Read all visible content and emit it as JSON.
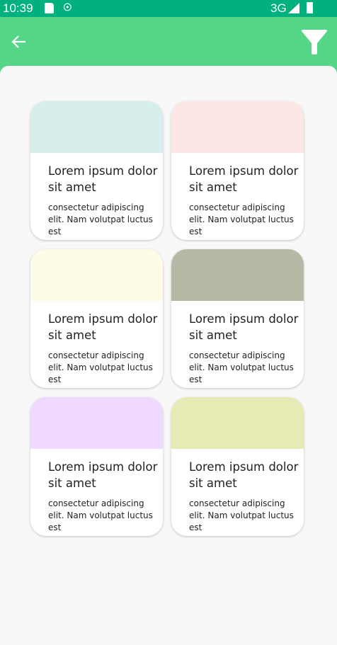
{
  "status_bar": {
    "time": "10:39",
    "network": "3G",
    "icons": [
      "sd-card-icon",
      "debug-icon",
      "signal-icon",
      "battery-icon"
    ]
  },
  "app_bar": {
    "back_icon": "arrow-left-icon",
    "filter_icon": "filter-icon"
  },
  "colors": {
    "status_bar": "#00b07d",
    "app_bar": "#55d686",
    "background": "#f8f8f8"
  },
  "cards": [
    {
      "title": "Lorem ipsum dolor sit amet",
      "body": "consectetur adipiscing elit. Nam volutpat luctus est",
      "color": "#d6efec"
    },
    {
      "title": "Lorem ipsum dolor sit amet",
      "body": "consectetur adipiscing elit. Nam volutpat luctus est",
      "color": "#fde7e6"
    },
    {
      "title": "Lorem ipsum dolor sit amet",
      "body": "consectetur adipiscing elit. Nam volutpat luctus est",
      "color": "#fefbe6"
    },
    {
      "title": "Lorem ipsum dolor sit amet",
      "body": "consectetur adipiscing elit. Nam volutpat luctus est",
      "color": "#b5b9a5"
    },
    {
      "title": "Lorem ipsum dolor sit amet",
      "body": "consectetur adipiscing elit. Nam volutpat luctus est",
      "color": "#efd9fe"
    },
    {
      "title": "Lorem ipsum dolor sit amet",
      "body": "consectetur adipiscing elit. Nam volutpat luctus est",
      "color": "#e8eab6"
    }
  ]
}
